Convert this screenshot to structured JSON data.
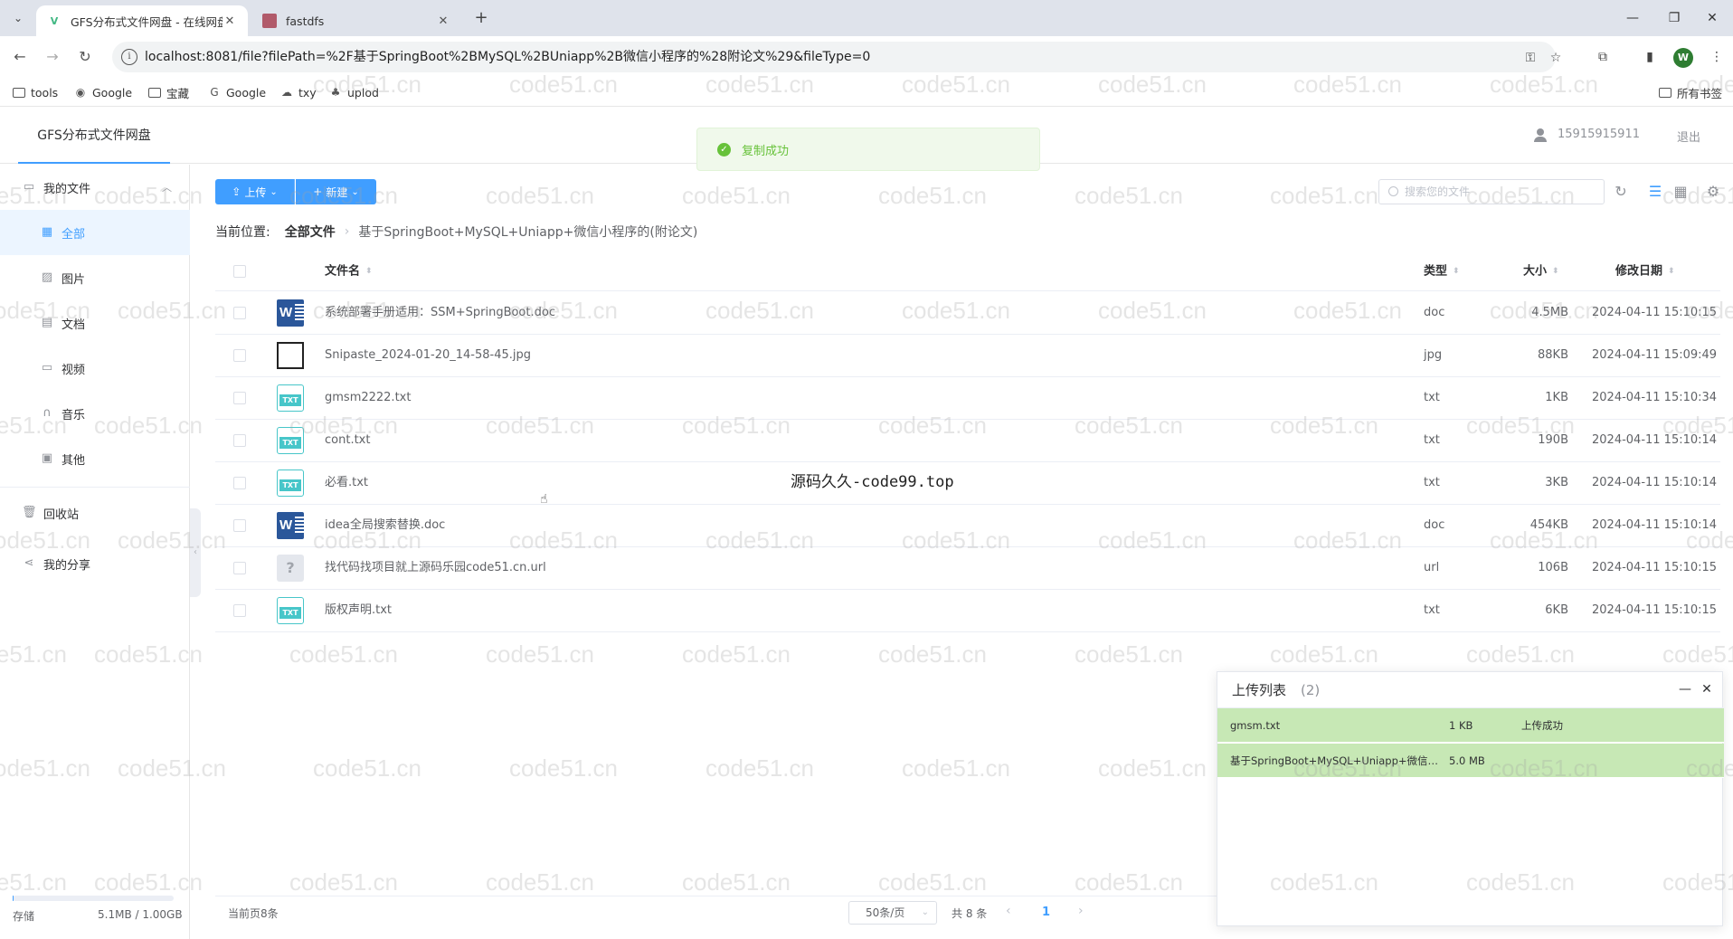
{
  "browser": {
    "tabs": [
      {
        "title": "GFS分布式文件网盘 - 在线网盘",
        "active": true
      },
      {
        "title": "fastdfs",
        "active": false
      }
    ],
    "url": "localhost:8081/file?filePath=%2F基于SpringBoot%2BMySQL%2BUniapp%2B微信小程序的%28附论文%29&fileType=0",
    "profile_initial": "W",
    "bookmarks": [
      "tools",
      "Google",
      "宝藏",
      "Google",
      "txy",
      "uplod"
    ],
    "all_bookmarks": "所有书签"
  },
  "app": {
    "brand": "GFS分布式文件网盘",
    "username": "15915915911",
    "logout": "退出",
    "toast": "复制成功"
  },
  "sidebar": {
    "my_files": "我的文件",
    "items": [
      {
        "label": "全部",
        "icon": "grid-icon",
        "active": true
      },
      {
        "label": "图片",
        "icon": "picture-icon"
      },
      {
        "label": "文档",
        "icon": "document-icon"
      },
      {
        "label": "视频",
        "icon": "video-icon"
      },
      {
        "label": "音乐",
        "icon": "headphones-icon"
      },
      {
        "label": "其他",
        "icon": "box-icon"
      }
    ],
    "recycle": "回收站",
    "share": "我的分享",
    "storage_label": "存储",
    "storage_value": "5.1MB / 1.00GB",
    "storage_fraction": 0.005
  },
  "toolbar": {
    "upload": "上传",
    "create": "新建",
    "search_placeholder": "搜索您的文件"
  },
  "breadcrumb": {
    "label": "当前位置:",
    "root": "全部文件",
    "current": "基于SpringBoot+MySQL+Uniapp+微信小程序的(附论文)"
  },
  "table": {
    "headers": {
      "name": "文件名",
      "type": "类型",
      "size": "大小",
      "date": "修改日期"
    },
    "rows": [
      {
        "name": "系统部署手册适用：SSM+SpringBoot.doc",
        "type": "doc",
        "size": "4.5MB",
        "date": "2024-04-11 15:10:15",
        "icon": "word"
      },
      {
        "name": "Snipaste_2024-01-20_14-58-45.jpg",
        "type": "jpg",
        "size": "88KB",
        "date": "2024-04-11 15:09:49",
        "icon": "image"
      },
      {
        "name": "gmsm2222.txt",
        "type": "txt",
        "size": "1KB",
        "date": "2024-04-11 15:10:34",
        "icon": "txt"
      },
      {
        "name": "cont.txt",
        "type": "txt",
        "size": "190B",
        "date": "2024-04-11 15:10:14",
        "icon": "txt"
      },
      {
        "name": "必看.txt",
        "type": "txt",
        "size": "3KB",
        "date": "2024-04-11 15:10:14",
        "icon": "txt"
      },
      {
        "name": "idea全局搜索替换.doc",
        "type": "doc",
        "size": "454KB",
        "date": "2024-04-11 15:10:14",
        "icon": "word"
      },
      {
        "name": "找代码找项目就上源码乐园code51.cn.url",
        "type": "url",
        "size": "106B",
        "date": "2024-04-11 15:10:15",
        "icon": "unknown"
      },
      {
        "name": "版权声明.txt",
        "type": "txt",
        "size": "6KB",
        "date": "2024-04-11 15:10:15",
        "icon": "txt"
      }
    ]
  },
  "caption": "源码久久-code99.top",
  "pagination": {
    "current_page_count": "当前页8条",
    "page_size": "50条/页",
    "total": "共 8 条",
    "page": "1"
  },
  "upload_list": {
    "title": "上传列表",
    "count": "(2)",
    "items": [
      {
        "name": "gmsm.txt",
        "size": "1 KB",
        "status": "上传成功"
      },
      {
        "name": "基于SpringBoot+MySQL+Uniapp+微信小程序的(附论文).zip",
        "size": "5.0 MB",
        "status": ""
      }
    ]
  },
  "watermark": "code51.cn"
}
